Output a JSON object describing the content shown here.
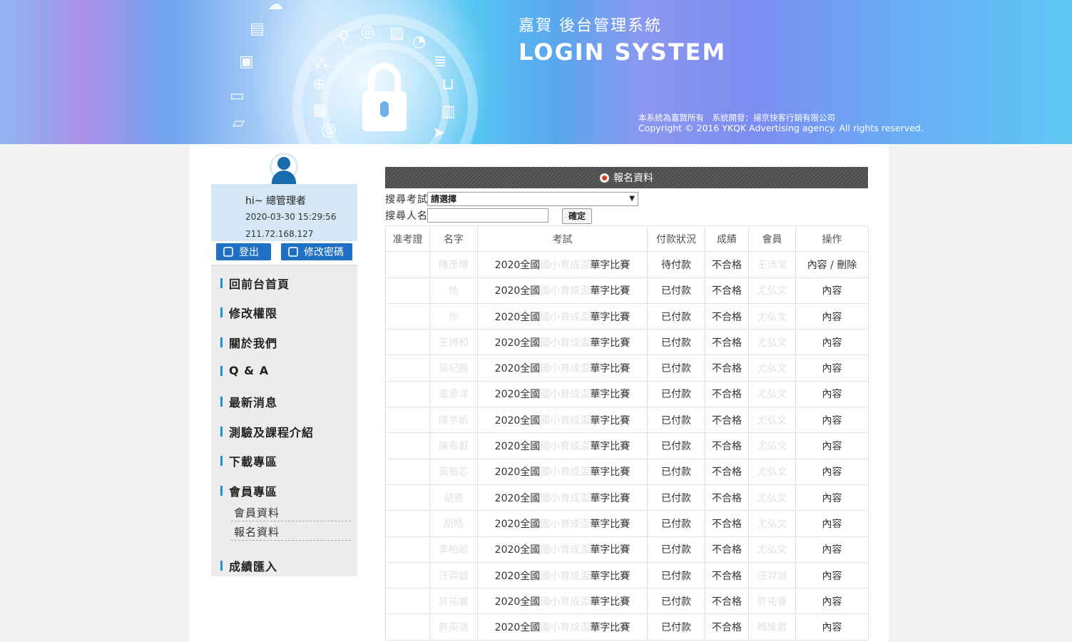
{
  "banner": {
    "title_cn": "嘉賀 後台管理系統",
    "title_en": "LOGIN SYSTEM",
    "copyright_line1": "本系統為嘉賀所有　系統開發：揚京快客行銷有限公司",
    "copyright_line2": "Copyright © 2016 YKQK Advertising agency. All rights reserved."
  },
  "user": {
    "greeting": "hi~ 總管理者",
    "datetime": "2020-03-30 15:29:56",
    "ip": "211.72.168.127",
    "logout_label": "登出",
    "change_password_label": "修改密碼"
  },
  "menu": {
    "items": [
      "回前台首頁",
      "修改權限",
      "關於我們",
      "Q & A",
      "最新消息",
      "測驗及課程介紹",
      "下載專區",
      "會員專區"
    ],
    "sub_items": [
      "會員資料",
      "報名資料"
    ],
    "last_item": "成績匯入"
  },
  "main": {
    "panel_title": "報名資料",
    "search_exam_label": "搜尋考試",
    "search_exam_selected": "請選擇",
    "search_name_label": "搜尋人名",
    "search_name_value": "",
    "confirm_label": "確定",
    "columns": [
      "准考證",
      "名字",
      "考試",
      "付款狀況",
      "成績",
      "會員",
      "操作"
    ],
    "rows": [
      {
        "ticket": "",
        "name": "陳彥博",
        "exam_a": "2020全國",
        "exam_b": "國小育成盃",
        "exam_c": "華字比賽",
        "payment": "待付款",
        "score": "不合格",
        "member": "王沛潔",
        "action": "內容 / 刪除"
      },
      {
        "ticket": "",
        "name": "他",
        "exam_a": "2020全國",
        "exam_b": "國小育成盃",
        "exam_c": "華字比賽",
        "payment": "已付款",
        "score": "不合格",
        "member": "尤弘文",
        "action": "內容"
      },
      {
        "ticket": "",
        "name": "你",
        "exam_a": "2020全國",
        "exam_b": "國小育成盃",
        "exam_c": "華字比賽",
        "payment": "已付款",
        "score": "不合格",
        "member": "尤弘文",
        "action": "內容"
      },
      {
        "ticket": "",
        "name": "王博和",
        "exam_a": "2020全國",
        "exam_b": "國小育成盃",
        "exam_c": "華字比賽",
        "payment": "已付款",
        "score": "不合格",
        "member": "尤弘文",
        "action": "內容"
      },
      {
        "ticket": "",
        "name": "吳紀騰",
        "exam_a": "2020全國",
        "exam_b": "國小育成盃",
        "exam_c": "華字比賽",
        "payment": "已付款",
        "score": "不合格",
        "member": "尤弘文",
        "action": "內容"
      },
      {
        "ticket": "",
        "name": "盧承洋",
        "exam_a": "2020全國",
        "exam_b": "國小育成盃",
        "exam_c": "華字比賽",
        "payment": "已付款",
        "score": "不合格",
        "member": "尤弘文",
        "action": "內容"
      },
      {
        "ticket": "",
        "name": "陳芋妡",
        "exam_a": "2020全國",
        "exam_b": "國小育成盃",
        "exam_c": "華字比賽",
        "payment": "已付款",
        "score": "不合格",
        "member": "尤弘文",
        "action": "內容"
      },
      {
        "ticket": "",
        "name": "陳宥叡",
        "exam_a": "2020全國",
        "exam_b": "國小育成盃",
        "exam_c": "華字比賽",
        "payment": "已付款",
        "score": "不合格",
        "member": "尤弘文",
        "action": "內容"
      },
      {
        "ticket": "",
        "name": "黃楷芯",
        "exam_a": "2020全國",
        "exam_b": "國小育成盃",
        "exam_c": "華字比賽",
        "payment": "已付款",
        "score": "不合格",
        "member": "尤弘文",
        "action": "內容"
      },
      {
        "ticket": "",
        "name": "胡雅",
        "exam_a": "2020全國",
        "exam_b": "國小育成盃",
        "exam_c": "華字比賽",
        "payment": "已付款",
        "score": "不合格",
        "member": "尤弘文",
        "action": "內容"
      },
      {
        "ticket": "",
        "name": "胡皓",
        "exam_a": "2020全國",
        "exam_b": "國小育成盃",
        "exam_c": "華字比賽",
        "payment": "已付款",
        "score": "不合格",
        "member": "尤弘文",
        "action": "內容"
      },
      {
        "ticket": "",
        "name": "李柏諺",
        "exam_a": "2020全國",
        "exam_b": "國小育成盃",
        "exam_c": "華字比賽",
        "payment": "已付款",
        "score": "不合格",
        "member": "尤弘文",
        "action": "內容"
      },
      {
        "ticket": "",
        "name": "汪羿誠",
        "exam_a": "2020全國",
        "exam_b": "國小育成盃",
        "exam_c": "華字比賽",
        "payment": "已付款",
        "score": "不合格",
        "member": "汪羿誠",
        "action": "內容"
      },
      {
        "ticket": "",
        "name": "許祐睿",
        "exam_a": "2020全國",
        "exam_b": "國小育成盃",
        "exam_c": "華字比賽",
        "payment": "已付款",
        "score": "不合格",
        "member": "許祐睿",
        "action": "內容"
      },
      {
        "ticket": "",
        "name": "許英浩",
        "exam_a": "2020全國",
        "exam_b": "國小育成盃",
        "exam_c": "華字比賽",
        "payment": "已付款",
        "score": "不合格",
        "member": "賴維君",
        "action": "內容"
      }
    ]
  }
}
